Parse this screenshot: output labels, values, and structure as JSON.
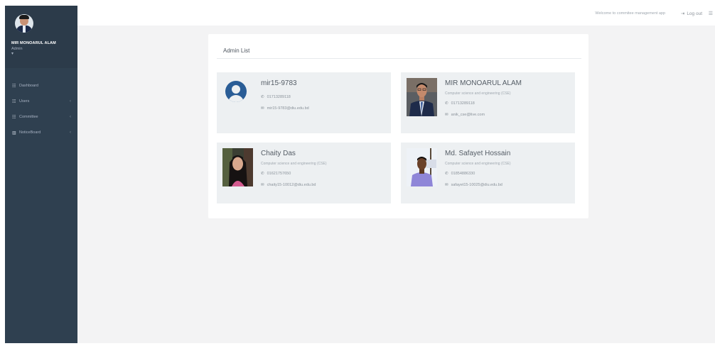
{
  "sidebar": {
    "user_name": "MIR MONOARUL ALAM",
    "user_role": "Admin",
    "user_dot": "▾",
    "nav": [
      {
        "icon": "grid-icon",
        "glyph": "☷",
        "label": "Dashboard",
        "has_chevron": false
      },
      {
        "icon": "users-icon",
        "glyph": "☷",
        "label": "Users",
        "has_chevron": true
      },
      {
        "icon": "committee-icon",
        "glyph": "☷",
        "label": "Committee",
        "has_chevron": true
      },
      {
        "icon": "chart-icon",
        "glyph": "▥",
        "label": "NoticeBoard",
        "has_chevron": true
      }
    ],
    "chevron": "‹"
  },
  "topbar": {
    "welcome": "Welcome to commitee management app",
    "logout_icon": "⇥",
    "logout_label": "Log out",
    "menu_icon": "☰"
  },
  "panel": {
    "title": "Admin List"
  },
  "admins": [
    {
      "name": "mir15-9783",
      "dept": "",
      "phone": "01713289118",
      "email": "mir15-9783@diu.edu.bd",
      "photo": "default-avatar"
    },
    {
      "name": "MIR MONOARUL ALAM",
      "dept": "Computer science and engineering (CSE)",
      "phone": "01713289118",
      "email": "anik_cse@live.com",
      "photo": "man-suit"
    },
    {
      "name": "Chaity Das",
      "dept": "Computer science and engineering (CSE)",
      "phone": "01621757650",
      "email": "chaity15-10012@diu.edu.bd",
      "photo": "woman"
    },
    {
      "name": "Md. Safayet Hossain",
      "dept": "Computer science and engineering (CSE)",
      "phone": "01854886330",
      "email": "safayet15-10025@diu.edu.bd",
      "photo": "man-casual"
    }
  ],
  "icons": {
    "phone": "✆",
    "mail": "✉"
  },
  "colors": {
    "sidebar": "#2f4050",
    "content_bg": "#f3f3f4",
    "card_bg": "#edf0f2",
    "avatar_blue": "#2a5d96"
  }
}
